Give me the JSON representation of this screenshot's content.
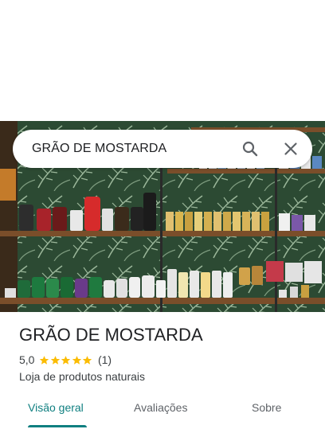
{
  "search": {
    "query": "GRÃO DE MOSTARDA",
    "search_icon": "search-icon",
    "close_icon": "close-icon"
  },
  "place": {
    "name": "GRÃO DE MOSTARDA",
    "rating": "5,0",
    "stars": 5,
    "review_count": "(1)",
    "category": "Loja de produtos naturais"
  },
  "tabs": [
    {
      "label": "Visão geral",
      "active": true
    },
    {
      "label": "Avaliações",
      "active": false
    },
    {
      "label": "Sobre",
      "active": false
    }
  ],
  "colors": {
    "accent": "#0f7f80",
    "star": "#fbbc04",
    "text": "#202124",
    "secondary": "#3c4043"
  }
}
